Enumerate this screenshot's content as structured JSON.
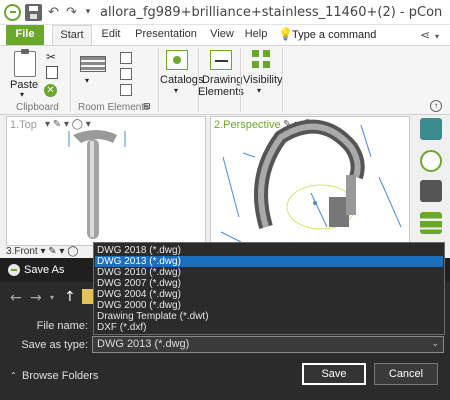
{
  "titlebar": {
    "title": "allora_fg989+brilliance+stainless_11460+(2) - pCon"
  },
  "ribbon": {
    "tabs": [
      "File",
      "Start",
      "Edit",
      "Presentation",
      "View",
      "Help"
    ],
    "tell_me": "Type a command",
    "groups": {
      "clipboard": {
        "paste": "Paste",
        "label": "Clipboard"
      },
      "room_elements": {
        "label": "Room Elements"
      },
      "catalogs": {
        "label": "Catalogs"
      },
      "drawing_elements": {
        "line1": "Drawing",
        "line2": "Elements"
      },
      "visibility": {
        "label": "Visibility"
      }
    }
  },
  "viewports": {
    "top": {
      "title": "1.Top"
    },
    "perspective": {
      "title": "2.Perspective"
    },
    "front": {
      "title": "3.Front"
    }
  },
  "dialog": {
    "title": "Save As",
    "file_name_label": "File name:",
    "save_as_type_label": "Save as type:",
    "save_as_type_value": "DWG 2013 (*.dwg)",
    "browse_folders": "Browse Folders",
    "save": "Save",
    "cancel": "Cancel",
    "type_options": [
      "DWG 2018 (*.dwg)",
      "DWG 2013 (*.dwg)",
      "DWG 2010 (*.dwg)",
      "DWG 2007 (*.dwg)",
      "DWG 2004 (*.dwg)",
      "DWG 2000 (*.dwg)",
      "Drawing Template (*.dwt)",
      "DXF (*.dxf)"
    ],
    "selected_option_index": 1
  },
  "colors": {
    "accent_green": "#6aa82c",
    "selection_blue": "#1a6fbf",
    "dialog_bg": "#2b2b2b"
  }
}
